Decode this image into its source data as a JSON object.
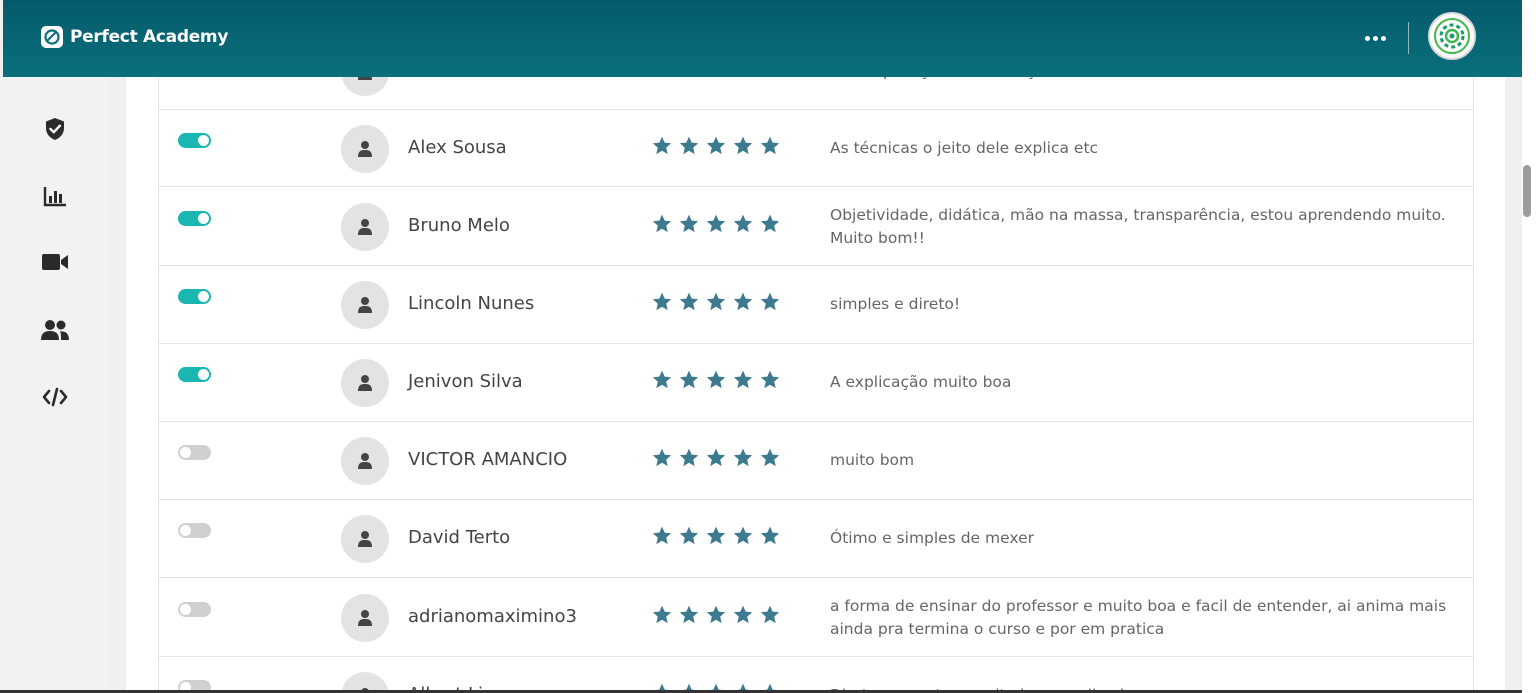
{
  "app": {
    "brand": "Perfect Academy"
  },
  "header": {
    "more_icon": "more-horizontal-icon",
    "avatar_icon": "gear-logo-icon"
  },
  "sidebar": {
    "items": [
      {
        "icon": "shield-check-icon"
      },
      {
        "icon": "bar-chart-icon"
      },
      {
        "icon": "video-camera-icon"
      },
      {
        "icon": "users-icon"
      },
      {
        "icon": "code-icon"
      }
    ]
  },
  "reviews": [
    {
      "enabled": true,
      "name": "leonardobarrosuoz",
      "rating": 5,
      "comment": "Boa explicação e informações diferenciadas",
      "partial": "top"
    },
    {
      "enabled": true,
      "name": "Alex Sousa",
      "rating": 5,
      "comment": "As técnicas o jeito dele explica etc"
    },
    {
      "enabled": true,
      "name": "Bruno Melo",
      "rating": 5,
      "comment": "Objetividade, didática, mão na massa, transparência, estou aprendendo muito. Muito bom!!"
    },
    {
      "enabled": true,
      "name": "Lincoln Nunes",
      "rating": 5,
      "comment": "simples e direto!"
    },
    {
      "enabled": true,
      "name": "Jenivon Silva",
      "rating": 5,
      "comment": "A explicação muito boa"
    },
    {
      "enabled": false,
      "name": "VICTOR AMANCIO",
      "rating": 5,
      "comment": "muito bom"
    },
    {
      "enabled": false,
      "name": "David Terto",
      "rating": 5,
      "comment": "Ótimo e simples de mexer"
    },
    {
      "enabled": false,
      "name": "adrianomaximino3",
      "rating": 5,
      "comment": "a forma de ensinar do professor e muito boa e facil de entender, ai anima mais ainda pra termina o curso e por em pratica"
    },
    {
      "enabled": false,
      "name": "Albert Lima",
      "rating": 5,
      "comment": "Direto ao ponto e muito bem explicado",
      "partial": "bottom"
    }
  ],
  "colors": {
    "header": "#0b6f7c",
    "toggle_on": "#1ab7b2",
    "toggle_off": "#d0d0d0",
    "star": "#3d7a8f"
  }
}
